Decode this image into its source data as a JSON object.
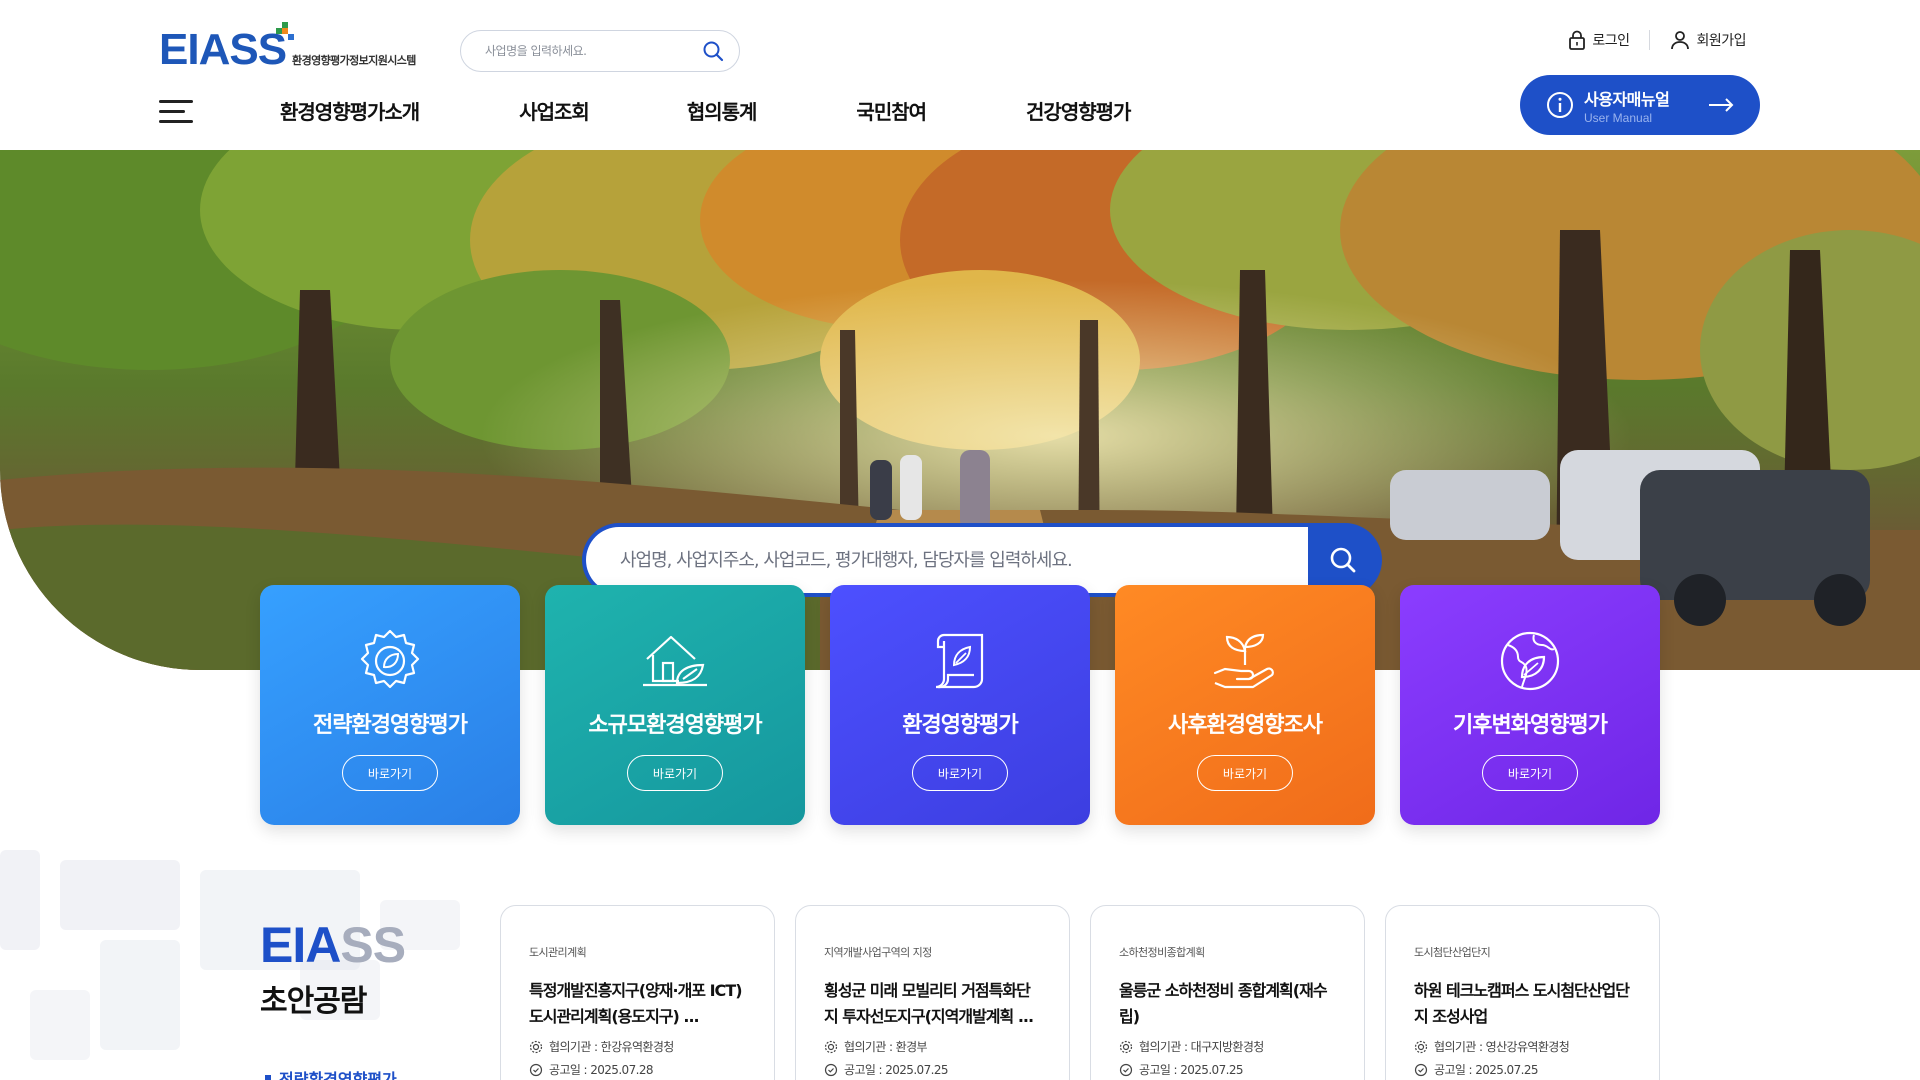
{
  "header": {
    "logo_text": "EIASS",
    "logo_subtitle": "환경영향평가정보지원시스템",
    "search_placeholder": "사업명을 입력하세요.",
    "login_label": "로그인",
    "signup_label": "회원가입",
    "manual_label": "사용자매뉴얼",
    "manual_sub": "User Manual",
    "nav": [
      "환경영향평가소개",
      "사업조회",
      "협의통계",
      "국민참여",
      "건강영향평가"
    ]
  },
  "hero": {
    "search_placeholder": "사업명, 사업지주소, 사업코드, 평가대행자, 담당자를 입력하세요."
  },
  "categories": [
    {
      "title": "전략환경영향평가",
      "button": "바로가기",
      "icon": "gear-leaf-icon",
      "color": "#2e8ef0"
    },
    {
      "title": "소규모환경영향평가",
      "button": "바로가기",
      "icon": "house-leaf-icon",
      "color": "#18a3a6"
    },
    {
      "title": "환경영향평가",
      "button": "바로가기",
      "icon": "scroll-leaf-icon",
      "color": "#4748ee"
    },
    {
      "title": "사후환경영향조사",
      "button": "바로가기",
      "icon": "hand-sprout-icon",
      "color": "#f27a1e"
    },
    {
      "title": "기후변화영향평가",
      "button": "바로가기",
      "icon": "globe-leaf-icon",
      "color": "#7b2fef"
    }
  ],
  "draft": {
    "title_eng_a": "EIA",
    "title_eng_b": "SS",
    "title_kor": "초안공람",
    "tab_label": "전략환경영향평가",
    "items": [
      {
        "category": "도시관리계획",
        "title": "특정개발진흥지구(양재·개포 ICT)도시관리계획(용도지구) ...",
        "agency": "협의기관 : 한강유역환경청",
        "date": "공고일 : 2025.07.28"
      },
      {
        "category": "지역개발사업구역의 지정",
        "title": "횡성군 미래 모빌리티 거점특화단지 투자선도지구(지역개발계획 ...",
        "agency": "협의기관 : 환경부",
        "date": "공고일 : 2025.07.25"
      },
      {
        "category": "소하천정비종합계획",
        "title": "울릉군 소하천정비 종합계획(재수립)",
        "agency": "협의기관 : 대구지방환경청",
        "date": "공고일 : 2025.07.25"
      },
      {
        "category": "도시첨단산업단지",
        "title": "하원 테크노캠퍼스 도시첨단산업단지 조성사업",
        "agency": "협의기관 : 영산강유역환경청",
        "date": "공고일 : 2025.07.25"
      }
    ]
  },
  "colors": {
    "primary": "#1e50c8",
    "logo": "#1e57b8"
  }
}
